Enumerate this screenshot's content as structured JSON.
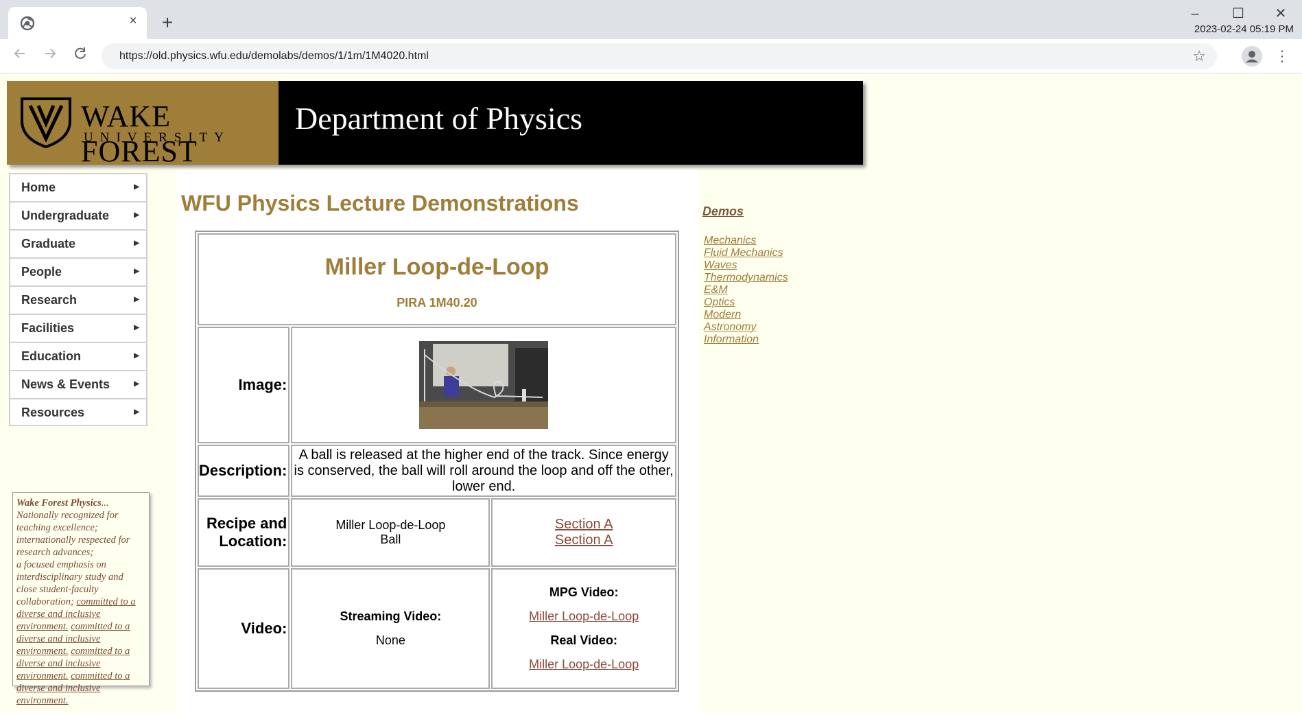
{
  "browser": {
    "tab_close": "×",
    "new_tab": "+",
    "window": {
      "minimize": "–",
      "maximize": "☐",
      "close": "✕"
    },
    "clock": "2023-02-24 05:19 PM",
    "url": "https://old.physics.wfu.edu/demolabs/demos/1/1m/1M4020.html"
  },
  "banner": {
    "university_name": "WAKE FOREST",
    "university_sub": "UNIVERSITY",
    "department": "Department of Physics"
  },
  "nav": {
    "items": [
      {
        "label": "Home"
      },
      {
        "label": "Undergraduate"
      },
      {
        "label": "Graduate"
      },
      {
        "label": "People"
      },
      {
        "label": "Research"
      },
      {
        "label": "Facilities"
      },
      {
        "label": "Education"
      },
      {
        "label": "News & Events"
      },
      {
        "label": "Resources"
      }
    ]
  },
  "promo": {
    "title": "Wake Forest Physics",
    "ellipsis": "...",
    "lines": [
      "Nationally recognized for teaching excellence;",
      "internationally respected for research advances;",
      "a focused emphasis on interdisciplinary study and close student-faculty collaboration;"
    ],
    "link_text": "committed to a diverse and inclusive environment."
  },
  "main": {
    "heading": "WFU Physics Lecture Demonstrations",
    "demo_title": "Miller Loop-de-Loop",
    "pira": "PIRA 1M40.20",
    "image_label": "Image:",
    "description_label": "Description:",
    "description": "A ball is released at the higher end of the track. Since energy is conserved, the ball will roll around the loop and off the other, lower end.",
    "recipe_label": "Recipe and Location:",
    "recipe_lines": [
      "Miller Loop-de-Loop",
      "Ball"
    ],
    "sections": [
      "Section A",
      "Section A"
    ],
    "video_label": "Video:",
    "streaming_label": "Streaming Video:",
    "streaming_value": "None",
    "mpg_label": "MPG Video:",
    "mpg_link": "Miller Loop-de-Loop",
    "real_label": "Real Video:",
    "real_link": "Miller Loop-de-Loop"
  },
  "sidebar": {
    "heading": "Demos",
    "links": [
      "Mechanics",
      "Fluid Mechanics",
      "Waves",
      "Thermodynamics",
      "E&M",
      "Optics",
      "Modern",
      "Astronomy",
      "Information"
    ]
  }
}
